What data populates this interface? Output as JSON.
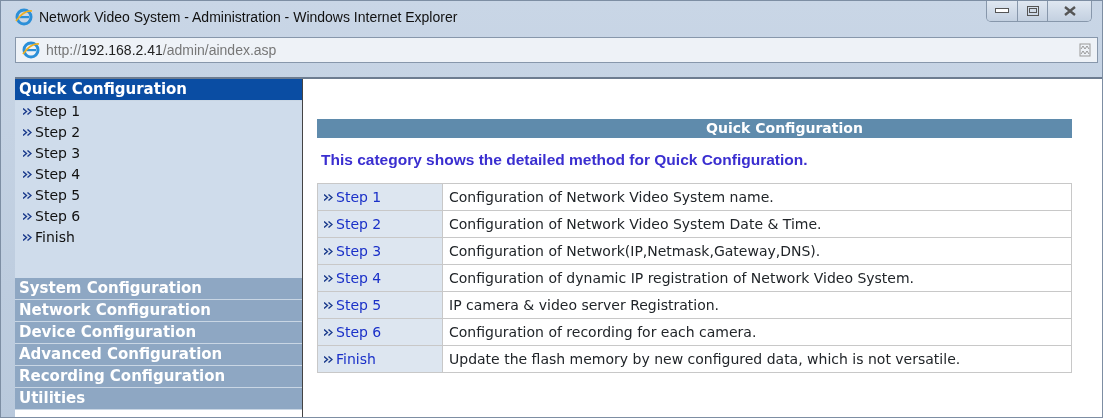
{
  "window": {
    "title": "Network Video System - Administration - Windows Internet Explorer"
  },
  "address_bar": {
    "scheme": "http://",
    "host": "192.168.2.41",
    "path": "/admin/aindex.asp"
  },
  "sidebar": {
    "sections": [
      {
        "label": "Quick Configuration",
        "expanded": true,
        "items": [
          "Step 1",
          "Step 2",
          "Step 3",
          "Step 4",
          "Step 5",
          "Step 6",
          "Finish"
        ]
      },
      {
        "label": "System Configuration",
        "expanded": false
      },
      {
        "label": "Network Configuration",
        "expanded": false
      },
      {
        "label": "Device Configuration",
        "expanded": false
      },
      {
        "label": "Advanced Configuration",
        "expanded": false
      },
      {
        "label": "Recording Configuration",
        "expanded": false
      },
      {
        "label": "Utilities",
        "expanded": false
      }
    ]
  },
  "content": {
    "heading": "Quick Configuration",
    "description": "This category shows the detailed method for Quick Configuration.",
    "rows": [
      {
        "step": "Step 1",
        "text": "Configuration of Network Video System name."
      },
      {
        "step": "Step 2",
        "text": "Configuration of Network Video System Date & Time."
      },
      {
        "step": "Step 3",
        "text": "Configuration of Network(IP,Netmask,Gateway,DNS)."
      },
      {
        "step": "Step 4",
        "text": "Configuration of dynamic IP registration of Network Video System."
      },
      {
        "step": "Step 5",
        "text": "IP camera & video server Registration."
      },
      {
        "step": "Step 6",
        "text": "Configuration of recording for each camera."
      },
      {
        "step": "Finish",
        "text": "Update the flash memory by new configured data, which is not versatile."
      }
    ]
  }
}
